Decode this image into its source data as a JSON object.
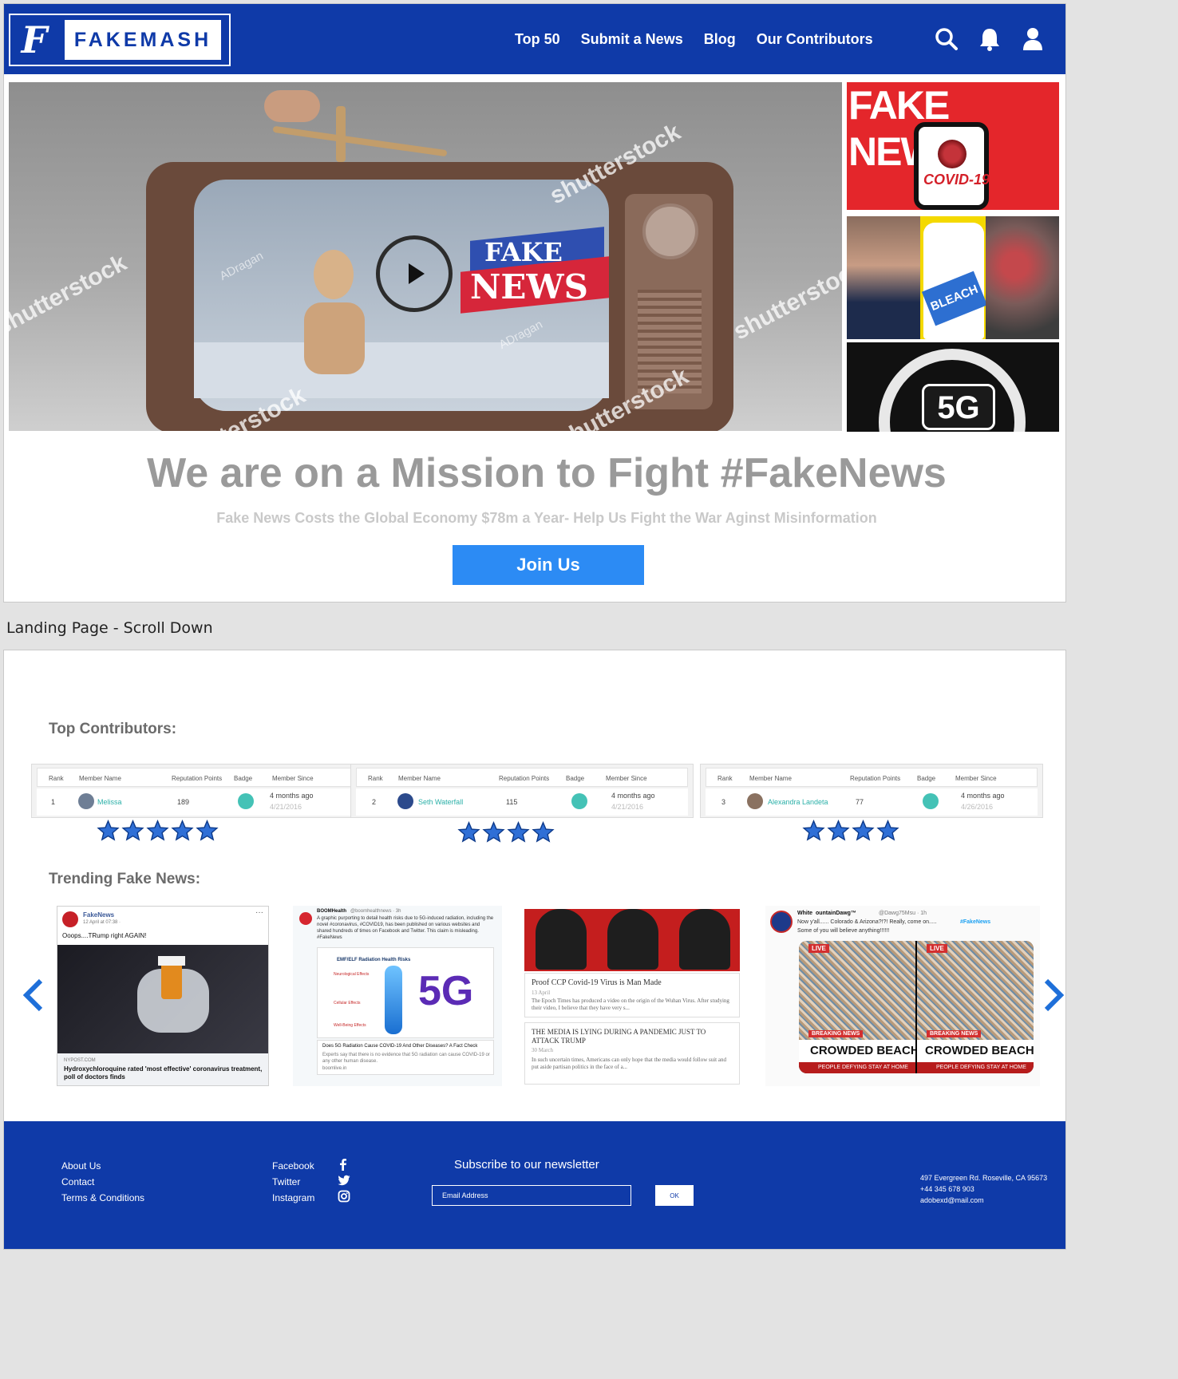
{
  "brand": {
    "mark": "F",
    "name": "FAKEMASH"
  },
  "nav": {
    "links": [
      "Top 50",
      "Submit a News",
      "Blog",
      "Our Contributors"
    ],
    "icons": [
      "search-icon",
      "bell-icon",
      "user-icon"
    ]
  },
  "hero": {
    "badge_line1": "FAKE",
    "badge_line2": "NEWS",
    "watermark": "shutterstock",
    "watermark_credit": "ADragan",
    "side_top_text": "FAKE NEWS",
    "side_top_phone_text": "COVID-19",
    "side_mid_label": "BLEACH",
    "side_bottom_label": "5G"
  },
  "mission": {
    "title": "We are on a Mission to Fight #FakeNews",
    "subtitle": "Fake News Costs the Global Economy $78m a Year- Help Us Fight the War Aginst Misinformation",
    "cta": "Join Us"
  },
  "caption": "Landing Page - Scroll Down",
  "contributors": {
    "title": "Top Contributors:",
    "columns": [
      "Rank",
      "Member Name",
      "Reputation Points",
      "Badge",
      "Member Since"
    ],
    "rows": [
      {
        "rank": "1",
        "name": "Melissa",
        "points": "189",
        "ago": "4 months ago",
        "date": "4/21/2016",
        "stars": 5
      },
      {
        "rank": "2",
        "name": "Seth Waterfall",
        "points": "115",
        "ago": "4 months ago",
        "date": "4/21/2016",
        "stars": 4
      },
      {
        "rank": "3",
        "name": "Alexandra Landeta",
        "points": "77",
        "ago": "4 months ago",
        "date": "4/26/2016",
        "stars": 4
      }
    ]
  },
  "trending": {
    "title": "Trending Fake News:",
    "card1": {
      "account": "FakeNews",
      "meta": "12 April at 07:38 ·",
      "text": "Ooops....TRump right AGAIN!",
      "source": "NYPOST.COM",
      "headline": "Hydroxychloroquine rated 'most effective' coronavirus treatment, poll of doctors finds"
    },
    "card2": {
      "account": "BOOMHealth",
      "handle": "@boomhealthnews · 3h",
      "text": "A graphic purporting to detail health risks due to 5G-induced radiation, including the novel #coronavirus, #COVID19, has been published on various websites and shared hundreds of times on Facebook and Twitter. This claim is misleading. #FakeNews",
      "graphic_title": "EMF/ELF Radiation Health Risks",
      "graphic_sections": [
        "Neurological Effects",
        "Cellular Effects",
        "Well-Being Effects"
      ],
      "graphic_big": "5G",
      "link_title": "Does 5G Radiation Cause COVID-19 And Other Diseases? A Fact Check",
      "link_desc": "Experts say that there is no evidence that 5G radiation can cause COVID-19 or any other human disease.",
      "link_url": "boomlive.in"
    },
    "card3": {
      "story1_title": "Proof CCP Covid-19 Virus is Man Made",
      "story1_date": "13 April",
      "story1_text": "The Epoch Times has produced a video on the origin of the Wuhan Virus. After studying their video, I believe that they have very s...",
      "story2_title": "THE MEDIA IS LYING DURING A PANDEMIC JUST TO ATTACK TRUMP",
      "story2_date": "30 March",
      "story2_text": "In such uncertain times, Americans can only hope that the media would follow suit and put aside partisan politics in the face of a..."
    },
    "card4": {
      "account": "White ountainDawg™",
      "handle": "@Dawg75Msu · 1h",
      "text": "Now y'all...... Colorado & Arizona?!?! Really, come on.....",
      "hashtag": "#FakeNews",
      "text2": "Some of you will believe anything!!!!!!",
      "live": "LIVE",
      "breaking": "BREAKING NEWS",
      "headline": "CROWDED BEACH",
      "ticker": "PEOPLE DEFYING STAY AT HOME"
    }
  },
  "footer": {
    "links": [
      "About Us",
      "Contact",
      "Terms & Conditions"
    ],
    "social": [
      {
        "label": "Facebook",
        "icon": "facebook-icon"
      },
      {
        "label": "Twitter",
        "icon": "twitter-icon"
      },
      {
        "label": "Instagram",
        "icon": "instagram-icon"
      }
    ],
    "newsletter_title": "Subscribe to our newsletter",
    "email_placeholder": "Email Address",
    "ok_label": "OK",
    "address": "497 Evergreen Rd. Roseville, CA 95673",
    "phone": "+44 345 678 903",
    "email": "adobexd@mail.com"
  },
  "colors": {
    "brand_blue": "#0f3aa8",
    "cta_blue": "#2c8bf4",
    "teal": "#2bb0a8"
  }
}
